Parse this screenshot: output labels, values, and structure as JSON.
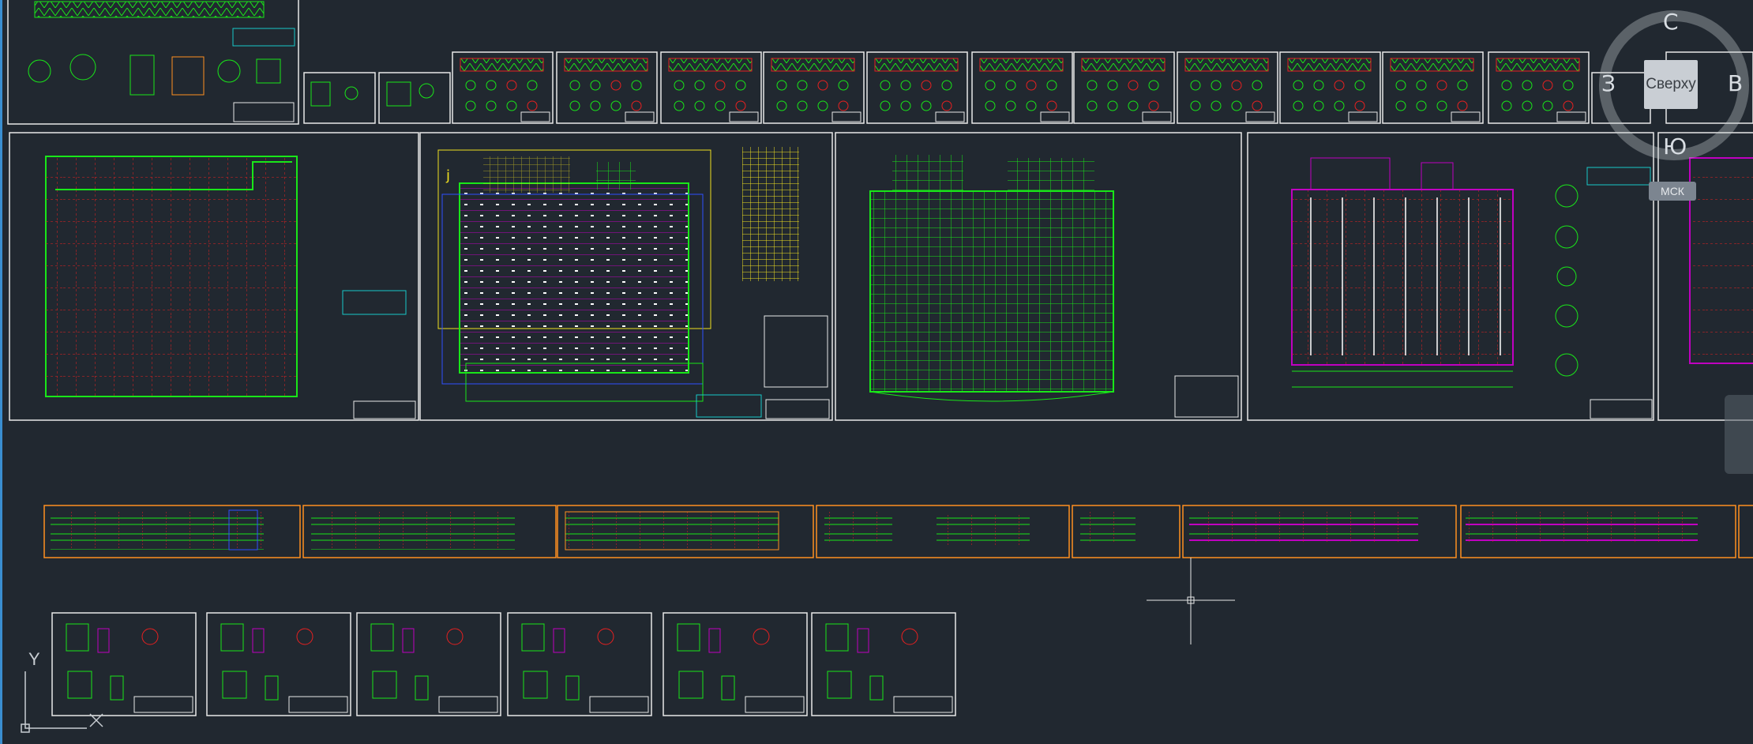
{
  "viewcube": {
    "north": "С",
    "south": "Ю",
    "east": "В",
    "west": "З",
    "top_face": "Сверху",
    "wcs": "МСК"
  },
  "ucs": {
    "y_label": "Y"
  },
  "colors": {
    "background": "#212830",
    "frame": "#e8e8e8",
    "green": "#19e619",
    "red": "#e82020",
    "magenta": "#c000c0",
    "yellow": "#f0e020",
    "cyan": "#18c8c8",
    "blue": "#3050ff",
    "orange": "#ff9020"
  }
}
